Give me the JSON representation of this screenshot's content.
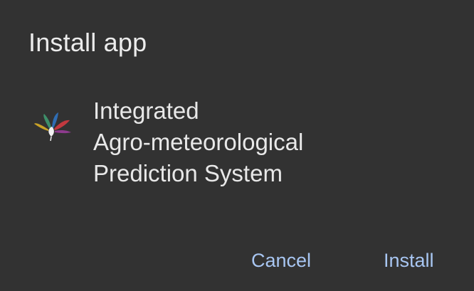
{
  "dialog": {
    "title": "Install app",
    "app": {
      "name_lines": [
        "Integrated",
        "Agro-meteorological",
        "Prediction System"
      ],
      "icon": "app-logo-icon"
    },
    "actions": {
      "cancel_label": "Cancel",
      "install_label": "Install"
    },
    "colors": {
      "background": "#323232",
      "text": "#e8e8e8",
      "accent": "#a8c6f2"
    }
  }
}
